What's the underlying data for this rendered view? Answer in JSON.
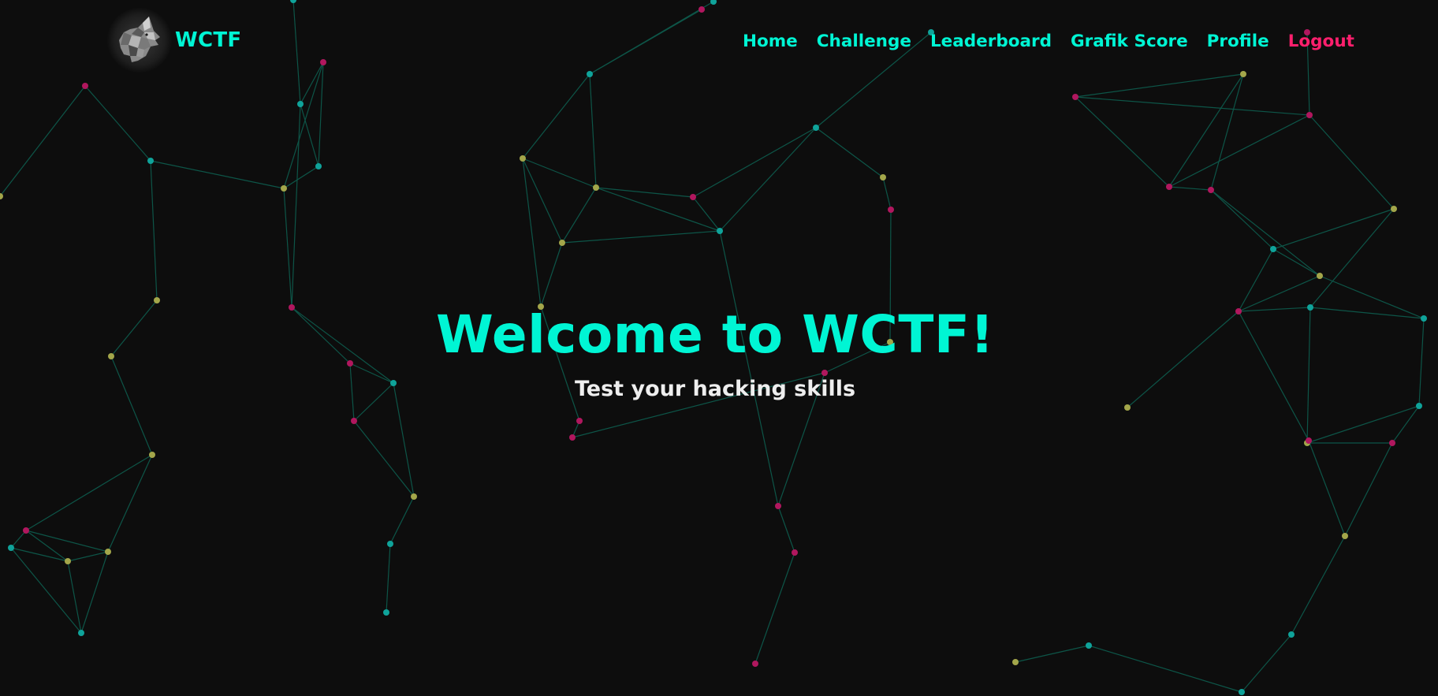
{
  "brand": {
    "name": "WCTF",
    "logo_icon": "wolf-head-icon"
  },
  "nav": {
    "items": [
      {
        "label": "Home"
      },
      {
        "label": "Challenge"
      },
      {
        "label": "Leaderboard"
      },
      {
        "label": "Grafik Score"
      },
      {
        "label": "Profile"
      },
      {
        "label": "Logout"
      }
    ]
  },
  "hero": {
    "title": "Welcome to WCTF!",
    "subtitle": "Test your hacking skills"
  },
  "colors": {
    "background": "#0d0d0d",
    "accent": "#00f5d4",
    "logout": "#ff1f6d",
    "node_teal": "#0fa39a",
    "node_olive": "#a3a64a",
    "node_pink": "#b0175e",
    "link_line": "#0e6e5c"
  }
}
